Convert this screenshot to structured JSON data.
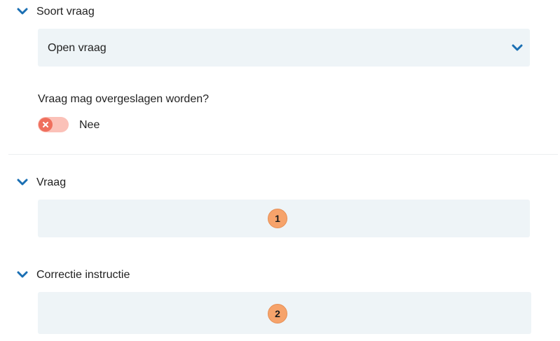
{
  "sections": {
    "question_type": {
      "title": "Soort vraag",
      "selected_value": "Open vraag"
    },
    "skip": {
      "label": "Vraag mag overgeslagen worden?",
      "toggle_text": "Nee",
      "toggle_on": false
    },
    "question": {
      "title": "Vraag",
      "marker": "1"
    },
    "correction": {
      "title": "Correctie instructie",
      "marker": "2"
    }
  },
  "colors": {
    "accent": "#1a6fb3",
    "field_bg": "#eef4f7",
    "toggle_off_track": "#fbc1b8",
    "toggle_off_knob": "#ef6f5d",
    "marker": "#f6a36b"
  },
  "icons": {
    "collapse": "chevron-down-icon",
    "toggle_off": "close-icon"
  }
}
